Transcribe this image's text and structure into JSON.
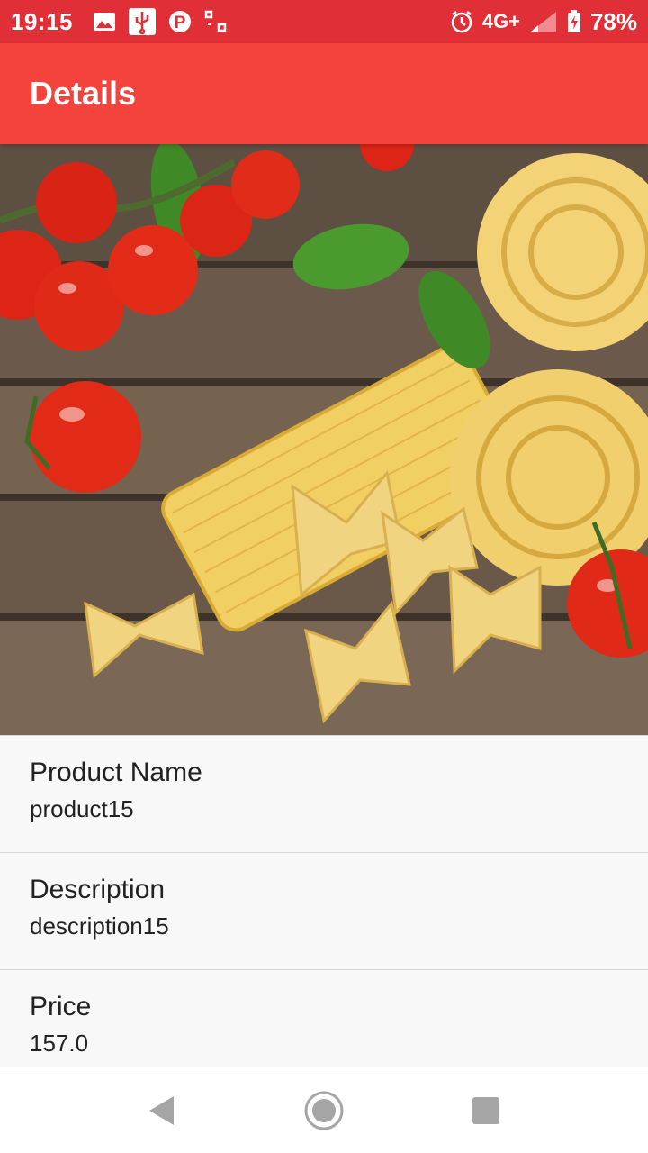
{
  "status_bar": {
    "time": "19:15",
    "left_icons": [
      "image-icon",
      "usb-icon",
      "parking-icon",
      "scan-icon"
    ],
    "network": "4G+",
    "battery_percent": "78%",
    "right_icons": [
      "alarm-icon",
      "signal-icon",
      "battery-charging-icon"
    ]
  },
  "app_bar": {
    "title": "Details",
    "background": "#f4433c"
  },
  "hero_image": {
    "subject": "pasta-tomatoes-basil-photo"
  },
  "details": [
    {
      "label": "Product Name",
      "value": "product15"
    },
    {
      "label": "Description",
      "value": "description15"
    },
    {
      "label": "Price",
      "value": "157.0"
    }
  ],
  "nav_bar": {
    "buttons": [
      "back-icon",
      "home-icon",
      "recents-icon"
    ]
  },
  "colors": {
    "status_bar": "#e12f37",
    "accent": "#f4433c"
  }
}
